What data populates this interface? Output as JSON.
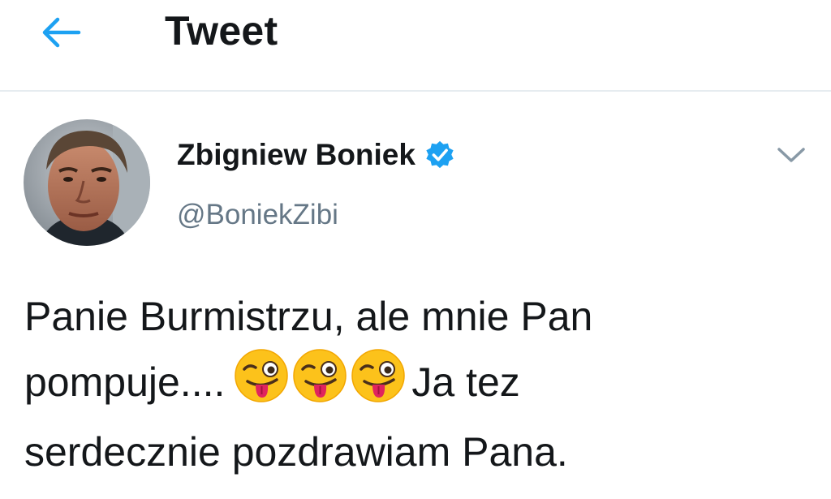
{
  "header": {
    "title": "Tweet",
    "back_icon": "arrow-left-icon",
    "accent_color": "#1da1f2"
  },
  "tweet": {
    "author": {
      "name": "Zbigniew Boniek",
      "handle": "@BoniekZibi",
      "verified": true,
      "verified_icon": "verified-badge-icon",
      "verified_color": "#1da1f2"
    },
    "menu_icon": "chevron-down-icon",
    "text": {
      "line1": "Panie Burmistrzu, ale mnie Pan",
      "line2_start": "pompuje....",
      "emojis": [
        "winking-face-with-tongue-emoji",
        "winking-face-with-tongue-emoji",
        "winking-face-with-tongue-emoji"
      ],
      "line2_end": "Ja tez",
      "line3": "serdecznie pozdrawiam Pana."
    }
  },
  "colors": {
    "text": "#14171a",
    "secondary_text": "#657786",
    "divider": "#e6ecf0"
  }
}
